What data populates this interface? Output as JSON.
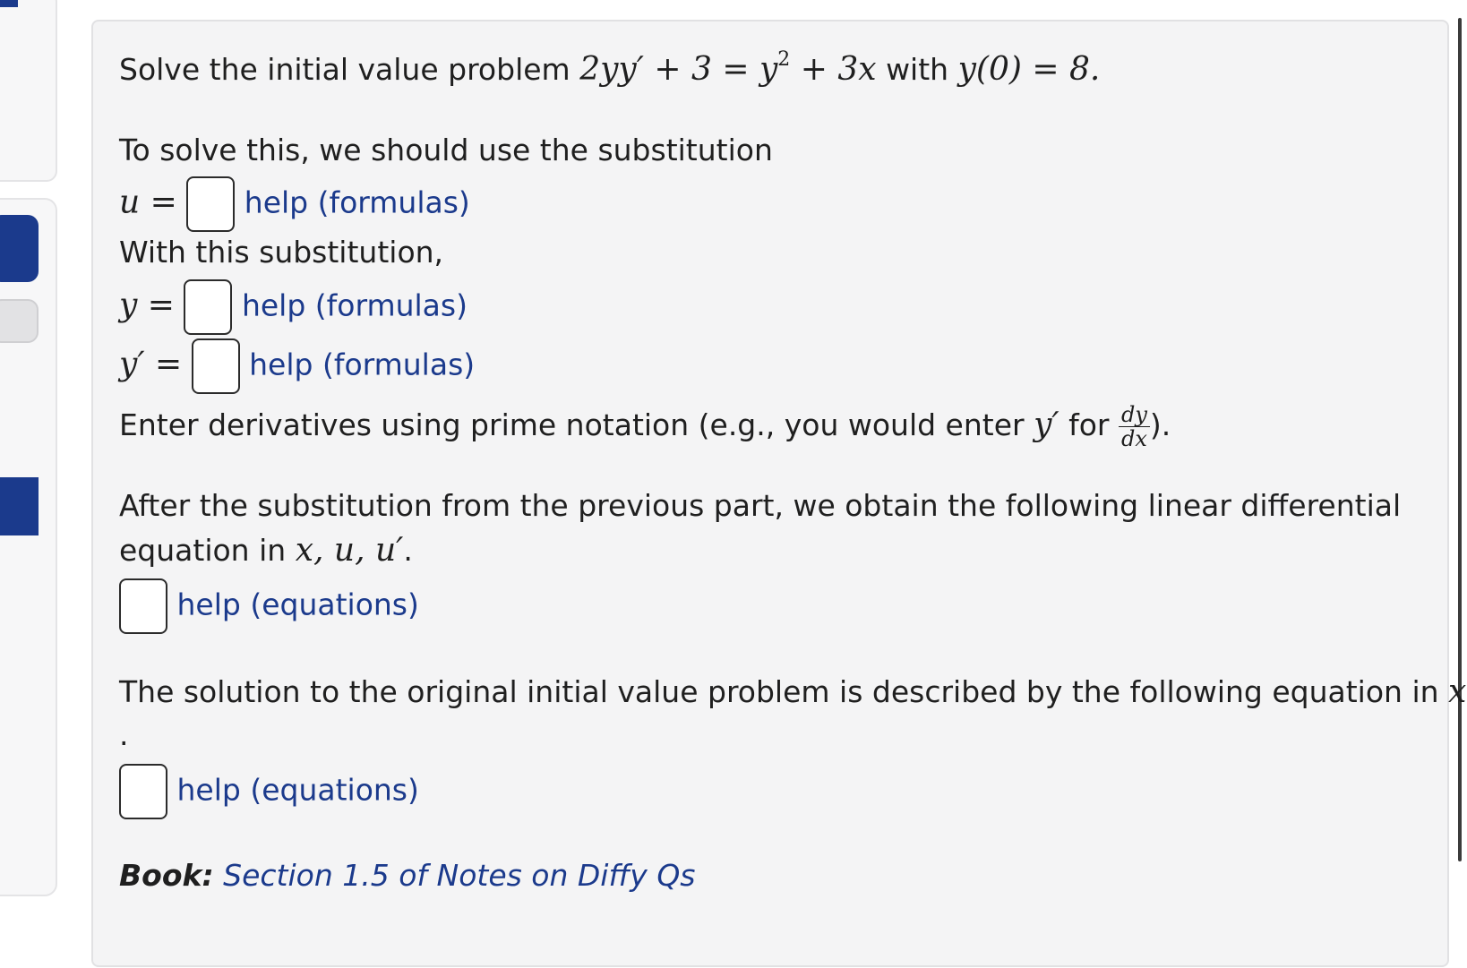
{
  "problem": {
    "intro": "Solve the initial value problem",
    "equation": "2yy′ + 3 = y",
    "equation_exp": "2",
    "equation_tail": " + 3x",
    "with_word": "with",
    "initial": "y(0) = 8.",
    "sub_intro": "To solve this, we should use the substitution",
    "u_label": "u =",
    "help_formulas": "help (formulas)",
    "with_sub": "With this substitution,",
    "y_label": "y =",
    "yprime_label": "y′ =",
    "deriv_note_a": "Enter derivatives using prime notation (e.g., you would enter",
    "deriv_note_y": "y′",
    "deriv_note_for": "for",
    "frac_num": "dy",
    "frac_den": "dx",
    "deriv_note_end": ").",
    "after_sub_line1": "After the substitution from the previous part, we obtain the following linear differential",
    "after_sub_line2": "equation in",
    "after_sub_vars": "x, u, u′",
    "after_sub_end": ".",
    "help_equations": "help (equations)",
    "solution_line": "The solution to the original initial value problem is described by the following equation in",
    "solution_vars": "x, y",
    "solution_dot": ".",
    "book_label": "Book:",
    "book_link": "Section 1.5 of Notes on Diffy Qs"
  },
  "colors": {
    "accent": "#1b3a8c",
    "panel_bg": "#f4f4f5",
    "text": "#1f1f1f"
  }
}
